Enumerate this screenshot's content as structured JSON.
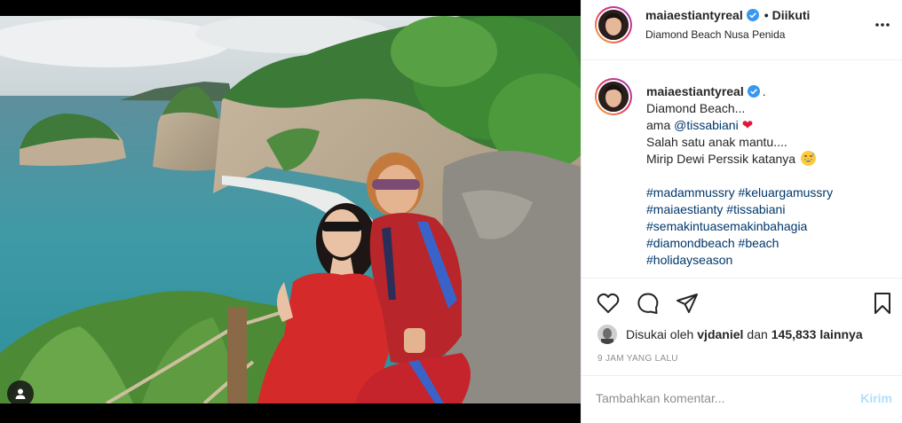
{
  "post": {
    "username": "maiaestiantyreal",
    "follow_separator": "•",
    "follow_status": "Diikuti",
    "location": "Diamond Beach Nusa Penida",
    "more_icon": "more-horizontal-icon",
    "verified_icon": "verified-badge-icon"
  },
  "caption": {
    "username": "maiaestiantyreal",
    "after_name": ".",
    "lines": {
      "l1": "Diamond Beach...",
      "l2_prefix": "ama ",
      "l2_mention": "@tissabiani",
      "l3": "Salah satu anak mantu....",
      "l4": "Mirip Dewi Perssik katanya",
      "h1a": "#madammussry",
      "h1b": "#keluargamussry",
      "h2a": "#maiaestianty",
      "h2b": "#tissabiani",
      "h3": "#semakintuasemakinbahagia",
      "h4a": "#diamondbeach",
      "h4b": "#beach",
      "h5": "#holidayseason"
    },
    "heart_icon": "red-heart-emoji",
    "laugh_icon": "grinning-sweat-emoji"
  },
  "actions": {
    "like_icon": "heart-icon",
    "comment_icon": "comment-icon",
    "share_icon": "share-icon",
    "save_icon": "bookmark-icon"
  },
  "likes": {
    "prefix": "Disukai oleh",
    "user": "vjdaniel",
    "middle": "dan",
    "count": "145,833",
    "suffix": "lainnya"
  },
  "timestamp": "9 JAM YANG LALU",
  "comment": {
    "placeholder": "Tambahkan komentar...",
    "post_label": "Kirim"
  },
  "colors": {
    "link": "#00376b",
    "verified": "#3897f0",
    "post_disabled": "#b2dffc",
    "muted": "#8e8e8e"
  }
}
